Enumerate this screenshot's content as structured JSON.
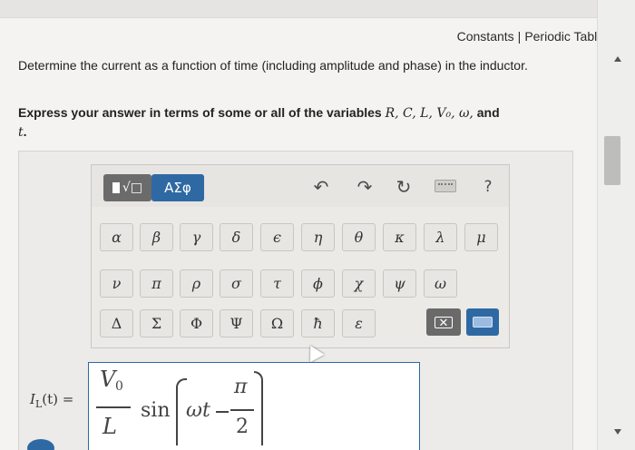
{
  "header": {
    "constants_link": "Constants",
    "separator": "|",
    "periodic_table_link": "Periodic Table"
  },
  "question": {
    "text": "Determine the current as a function of time (including amplitude and phase) in the inductor."
  },
  "instruction": {
    "prefix": "Express your answer in terms of some or all of the variables ",
    "variables": "R, C, L, V₀, ω,",
    "conjunction": " and",
    "last_variable": "t",
    "suffix": "."
  },
  "toolbar": {
    "template_button_label": "√□",
    "greek_button_label": "ΑΣφ",
    "undo_icon": "undo-icon",
    "redo_icon": "redo-icon",
    "reset_icon": "reset-icon",
    "keyboard_icon": "keyboard-icon",
    "help_label": "?",
    "accent_color": "#2f69a3",
    "row1": [
      "α",
      "β",
      "γ",
      "δ",
      "ϵ",
      "η",
      "θ",
      "κ",
      "λ",
      "μ"
    ],
    "row2": [
      "ν",
      "π",
      "ρ",
      "σ",
      "τ",
      "ϕ",
      "χ",
      "ψ",
      "ω"
    ],
    "row3": [
      "Δ",
      "Σ",
      "Φ",
      "Ψ",
      "Ω",
      "ħ",
      "ε"
    ],
    "delete_label": "✕"
  },
  "answer": {
    "label_main": "I",
    "label_sub": "L",
    "label_rest": "(t) =",
    "numerator": "V",
    "numerator_sub": "0",
    "denominator": "L",
    "function": "sin",
    "argument": "ωt",
    "pi": "π",
    "two": "2"
  }
}
